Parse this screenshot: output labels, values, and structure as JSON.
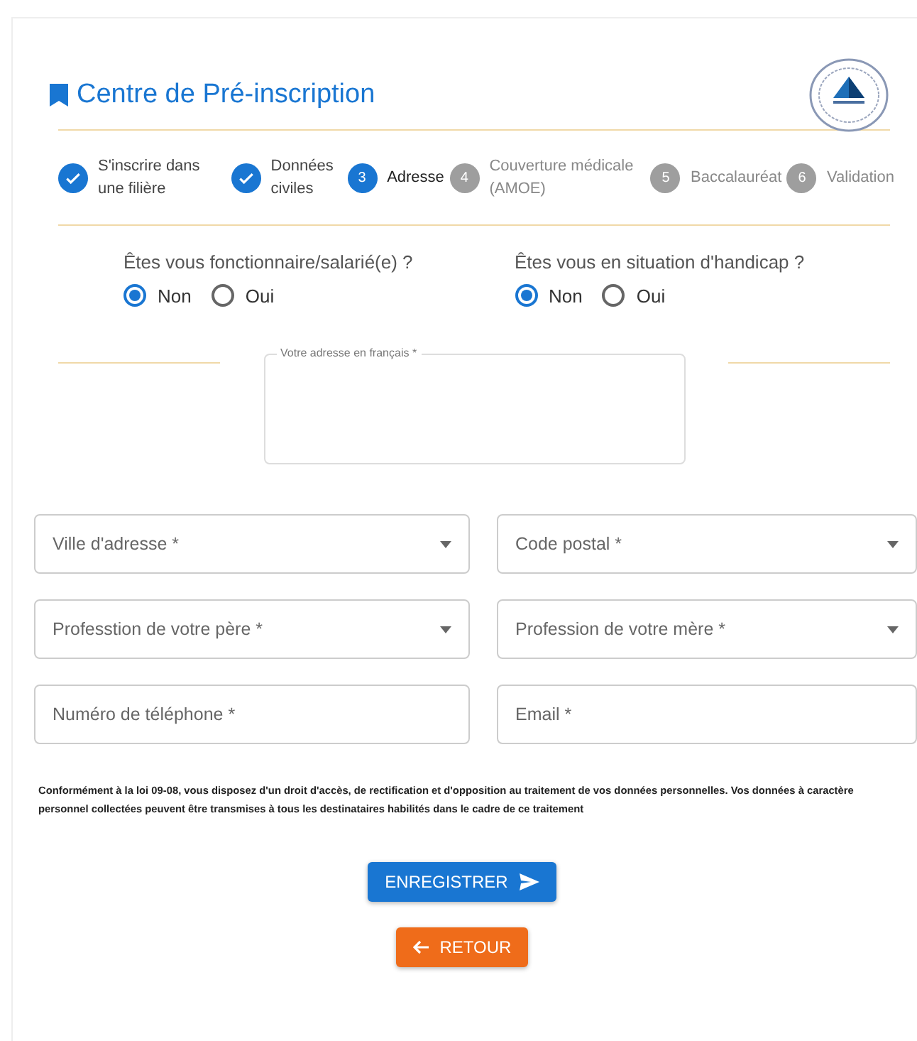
{
  "header": {
    "title": "Centre de Pré-inscription"
  },
  "steps": [
    {
      "label": "S'inscrire dans une filière",
      "completed": true,
      "selected": false
    },
    {
      "label": "Données civiles",
      "completed": true,
      "selected": false
    },
    {
      "label": "Adresse",
      "number": "3",
      "completed": false,
      "selected": true
    },
    {
      "label": "Couverture médicale (AMOE)",
      "number": "4",
      "completed": false,
      "selected": false
    },
    {
      "label": "Baccalauréat",
      "number": "5",
      "completed": false,
      "selected": false
    },
    {
      "label": "Validation",
      "number": "6",
      "completed": false,
      "selected": false
    }
  ],
  "questions": [
    {
      "label": "Êtes vous fonctionnaire/salarié(e) ?",
      "options": [
        {
          "label": "Non",
          "selected": true
        },
        {
          "label": "Oui",
          "selected": false
        }
      ]
    },
    {
      "label": "Êtes vous en situation d'handicap ?",
      "options": [
        {
          "label": "Non",
          "selected": true
        },
        {
          "label": "Oui",
          "selected": false
        }
      ]
    }
  ],
  "address": {
    "label": "Votre adresse en français *"
  },
  "fields": [
    {
      "label": "Ville d'adresse *",
      "kind": "select"
    },
    {
      "label": "Code postal *",
      "kind": "select"
    },
    {
      "label": "Professtion de votre père *",
      "kind": "select"
    },
    {
      "label": "Profession de votre mère *",
      "kind": "select"
    },
    {
      "label": "Numéro de téléphone *",
      "kind": "text"
    },
    {
      "label": "Email *",
      "kind": "text"
    }
  ],
  "notice": "Conformément à la loi 09-08, vous disposez d'un droit d'accès, de rectification et d'opposition au traitement de vos données personnelles. Vos données à caractère personnel collectées peuvent être transmises à tous les destinataires habilités dans le cadre de ce traitement",
  "buttons": [
    {
      "label": "ENREGISTRER",
      "kind": "submit"
    },
    {
      "label": "RETOUR",
      "kind": "back"
    }
  ]
}
